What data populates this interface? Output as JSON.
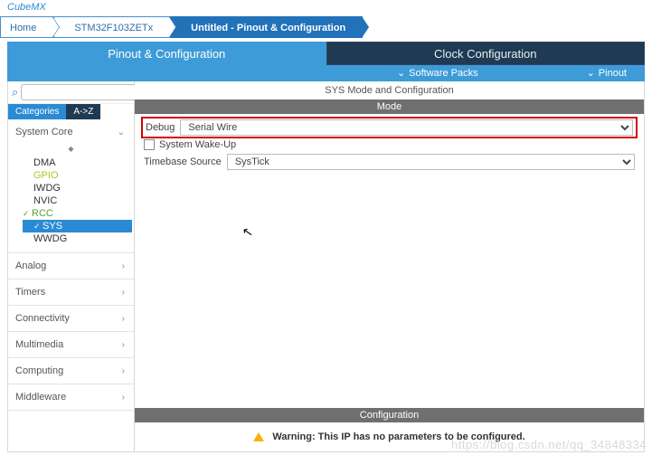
{
  "app_title": "CubeMX",
  "breadcrumb": {
    "home": "Home",
    "chip": "STM32F103ZETx",
    "file": "Untitled - Pinout & Configuration"
  },
  "main_tabs": {
    "left": "Pinout & Configuration",
    "right": "Clock Configuration"
  },
  "sub_bar": {
    "software_packs": "Software Packs",
    "pinout": "Pinout"
  },
  "search": {
    "placeholder": ""
  },
  "cat_tabs": {
    "categories": "Categories",
    "az": "A->Z"
  },
  "groups": {
    "system_core": {
      "label": "System Core",
      "items": [
        "DMA",
        "GPIO",
        "IWDG",
        "NVIC",
        "RCC",
        "SYS",
        "WWDG"
      ]
    },
    "analog": "Analog",
    "timers": "Timers",
    "connectivity": "Connectivity",
    "multimedia": "Multimedia",
    "computing": "Computing",
    "middleware": "Middleware"
  },
  "panel": {
    "title": "SYS Mode and Configuration",
    "mode_label": "Mode",
    "config_label": "Configuration",
    "debug_label": "Debug",
    "debug_value": "Serial Wire",
    "wakeup_label": "System Wake-Up",
    "timebase_label": "Timebase Source",
    "timebase_value": "SysTick",
    "warning": "Warning: This IP has no parameters to be configured."
  },
  "watermark": "https://blog.csdn.net/qq_34848334"
}
